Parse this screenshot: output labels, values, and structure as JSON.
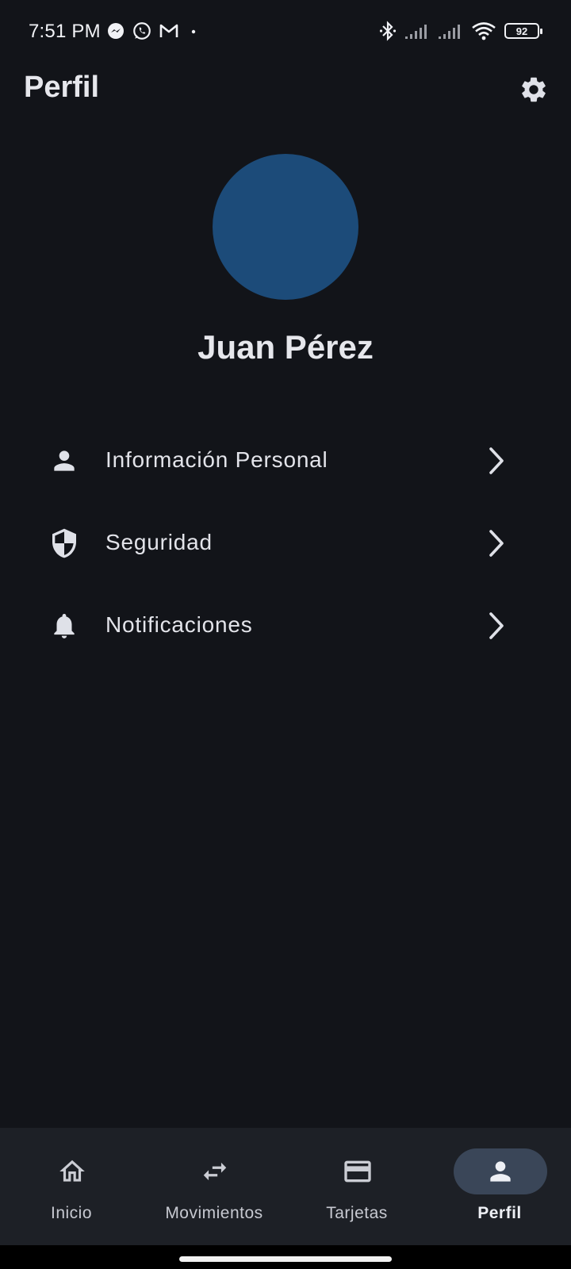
{
  "status_bar": {
    "time": "7:51 PM",
    "battery": "92",
    "left_icons": [
      "messenger-icon",
      "whatsapp-icon",
      "gmail-icon",
      "dot-icon"
    ],
    "right_icons": [
      "bluetooth-icon",
      "signal-icon",
      "signal-icon",
      "wifi-icon",
      "battery-icon"
    ]
  },
  "app_bar": {
    "title": "Perfil",
    "action_icon": "gear-icon"
  },
  "profile": {
    "name": "Juan Pérez",
    "avatar_color": "#1c4b79"
  },
  "menu": {
    "items": [
      {
        "label": "Información Personal",
        "icon": "person-icon"
      },
      {
        "label": "Seguridad",
        "icon": "shield-icon"
      },
      {
        "label": "Notificaciones",
        "icon": "bell-icon"
      }
    ]
  },
  "bottom_nav": {
    "items": [
      {
        "label": "Inicio",
        "icon": "home-icon",
        "active": false
      },
      {
        "label": "Movimientos",
        "icon": "swap-arrows-icon",
        "active": false
      },
      {
        "label": "Tarjetas",
        "icon": "credit-card-icon",
        "active": false
      },
      {
        "label": "Perfil",
        "icon": "person-icon",
        "active": true
      }
    ]
  },
  "colors": {
    "background": "#121419",
    "nav_background": "#1d2026",
    "active_indicator": "#3a4658",
    "text": "#e3e4ea"
  }
}
